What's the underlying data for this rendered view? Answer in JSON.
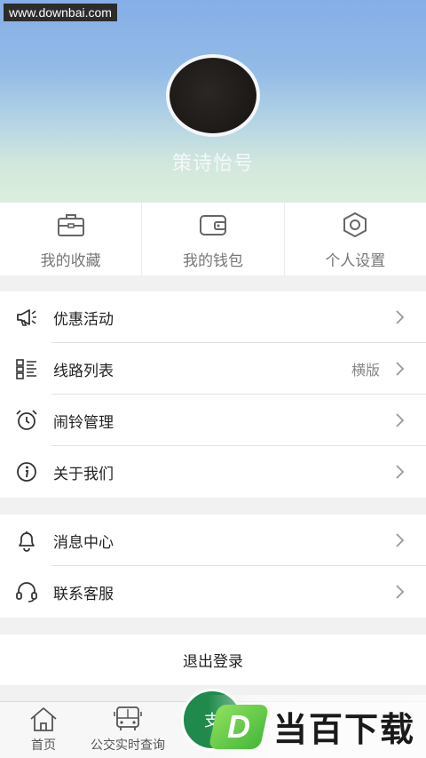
{
  "watermark_top": "www.downbai.com",
  "profile": {
    "username": "策诗怡号"
  },
  "quick_actions": [
    {
      "label": "我的收藏",
      "icon": "briefcase-icon"
    },
    {
      "label": "我的钱包",
      "icon": "wallet-icon"
    },
    {
      "label": "个人设置",
      "icon": "gear-icon"
    }
  ],
  "menu_group_1": [
    {
      "label": "优惠活动",
      "icon": "megaphone-icon",
      "value": ""
    },
    {
      "label": "线路列表",
      "icon": "list-icon",
      "value": "横版"
    },
    {
      "label": "闹铃管理",
      "icon": "alarm-clock-icon",
      "value": ""
    },
    {
      "label": "关于我们",
      "icon": "info-icon",
      "value": ""
    }
  ],
  "menu_group_2": [
    {
      "label": "消息中心",
      "icon": "bell-icon",
      "value": ""
    },
    {
      "label": "联系客服",
      "icon": "headset-icon",
      "value": ""
    }
  ],
  "logout_label": "退出登录",
  "tabbar": {
    "home": "首页",
    "bus": "公交实时查询",
    "center": "支",
    "right_1": "",
    "right_2": ""
  },
  "watermark_bottom": {
    "logo_letter": "D",
    "text": "当百下载"
  },
  "colors": {
    "accent_green": "#1f8a4c",
    "header_top": "#86aee8",
    "header_bottom": "#dbeedd"
  }
}
